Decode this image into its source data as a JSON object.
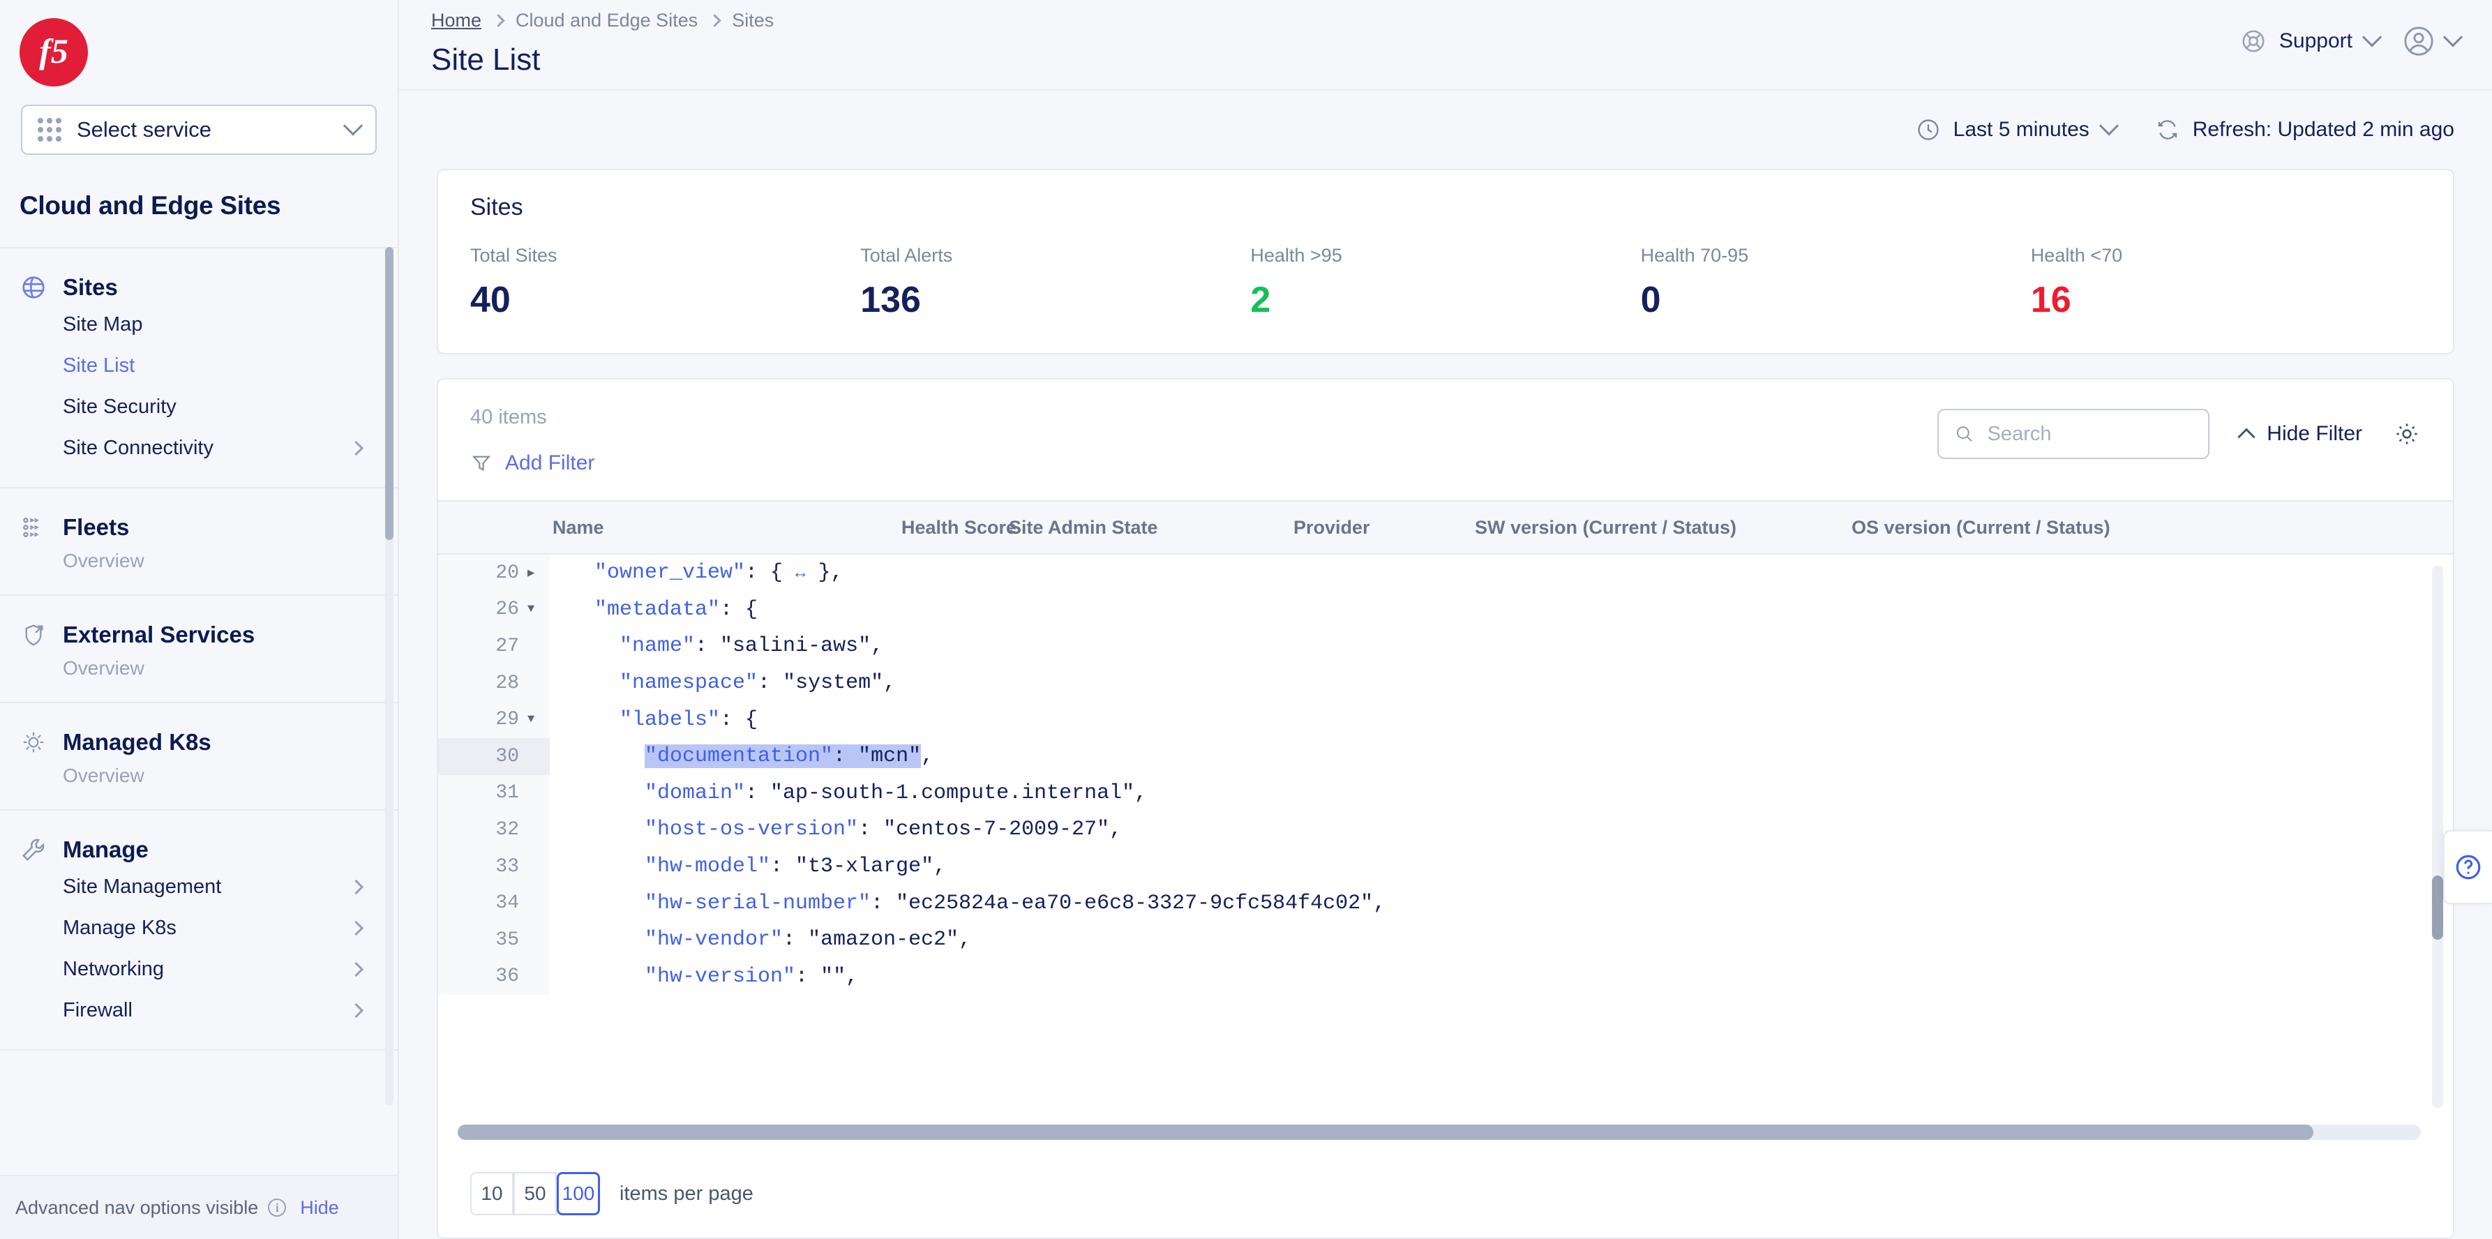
{
  "brand": {
    "logo_text": "f5",
    "accent": "#e21d38"
  },
  "sidebar": {
    "service_selector": {
      "label": "Select service",
      "icon": "grid-dots-icon"
    },
    "heading": "Cloud and Edge Sites",
    "groups": [
      {
        "title": "Sites",
        "icon": "globe-icon",
        "subtitle": null,
        "items": [
          {
            "label": "Site Map",
            "active": false,
            "chevron": false
          },
          {
            "label": "Site List",
            "active": true,
            "chevron": false
          },
          {
            "label": "Site Security",
            "active": false,
            "chevron": false
          },
          {
            "label": "Site Connectivity",
            "active": false,
            "chevron": true
          }
        ]
      },
      {
        "title": "Fleets",
        "icon": "fleets-icon",
        "subtitle": "Overview",
        "items": []
      },
      {
        "title": "External Services",
        "icon": "shield-arrow-icon",
        "subtitle": "Overview",
        "items": []
      },
      {
        "title": "Managed K8s",
        "icon": "helm-wheel-icon",
        "subtitle": "Overview",
        "items": []
      },
      {
        "title": "Manage",
        "icon": "wrench-icon",
        "subtitle": null,
        "items": [
          {
            "label": "Site Management",
            "active": false,
            "chevron": true
          },
          {
            "label": "Manage K8s",
            "active": false,
            "chevron": true
          },
          {
            "label": "Networking",
            "active": false,
            "chevron": true
          },
          {
            "label": "Firewall",
            "active": false,
            "chevron": true
          }
        ]
      }
    ],
    "footer": {
      "text": "Advanced nav options visible",
      "info_icon": "info-icon",
      "hide_label": "Hide"
    }
  },
  "header": {
    "breadcrumbs": [
      "Home",
      "Cloud and Edge Sites",
      "Sites"
    ],
    "title": "Site List",
    "support_label": "Support",
    "support_icon": "lifebuoy-icon",
    "account_icon": "user-circle-icon"
  },
  "toolbar": {
    "time_range": "Last 5 minutes",
    "time_icon": "clock-icon",
    "refresh_label": "Refresh: Updated 2 min ago",
    "refresh_icon": "refresh-icon"
  },
  "stats": {
    "title": "Sites",
    "cards": [
      {
        "label": "Total Sites",
        "value": "40",
        "color": "#16205c"
      },
      {
        "label": "Total Alerts",
        "value": "136",
        "color": "#16205c"
      },
      {
        "label": "Health >95",
        "value": "2",
        "color": "#13c05a"
      },
      {
        "label": "Health 70-95",
        "value": "0",
        "color": "#16205c"
      },
      {
        "label": "Health <70",
        "value": "16",
        "color": "#ee1b2e"
      }
    ]
  },
  "table": {
    "items_count": "40 items",
    "add_filter_label": "Add Filter",
    "add_filter_icon": "funnel-icon",
    "search_placeholder": "Search",
    "search_value": "",
    "search_icon": "search-icon",
    "hide_filter_label": "Hide Filter",
    "settings_icon": "gear-icon",
    "columns": [
      "Name",
      "Health Score",
      "Site Admin State",
      "Provider",
      "SW version (Current / Status)",
      "OS version (Current / Status)"
    ]
  },
  "code_viewer": {
    "lines": [
      {
        "num": "20",
        "fold": "collapsed",
        "highlight": false,
        "indent": 1,
        "parts": [
          {
            "t": "\"owner_view\"",
            "c": "k"
          },
          {
            "t": ": { ",
            "c": "p"
          },
          {
            "t": "↔",
            "c": "e"
          },
          {
            "t": " },",
            "c": "p"
          }
        ]
      },
      {
        "num": "26",
        "fold": "expanded",
        "highlight": false,
        "indent": 1,
        "parts": [
          {
            "t": "\"metadata\"",
            "c": "k"
          },
          {
            "t": ": {",
            "c": "p"
          }
        ]
      },
      {
        "num": "27",
        "fold": "none",
        "highlight": false,
        "indent": 2,
        "parts": [
          {
            "t": "\"name\"",
            "c": "k"
          },
          {
            "t": ": ",
            "c": "p"
          },
          {
            "t": "\"salini-aws\"",
            "c": "v"
          },
          {
            "t": ",",
            "c": "p"
          }
        ]
      },
      {
        "num": "28",
        "fold": "none",
        "highlight": false,
        "indent": 2,
        "parts": [
          {
            "t": "\"namespace\"",
            "c": "k"
          },
          {
            "t": ": ",
            "c": "p"
          },
          {
            "t": "\"system\"",
            "c": "v"
          },
          {
            "t": ",",
            "c": "p"
          }
        ]
      },
      {
        "num": "29",
        "fold": "expanded",
        "highlight": false,
        "indent": 2,
        "parts": [
          {
            "t": "\"labels\"",
            "c": "k"
          },
          {
            "t": ": {",
            "c": "p"
          }
        ]
      },
      {
        "num": "30",
        "fold": "none",
        "highlight": true,
        "indent": 3,
        "selected": true,
        "parts": [
          {
            "t": "\"documentation\"",
            "c": "k sel"
          },
          {
            "t": ": ",
            "c": "p sel"
          },
          {
            "t": "\"mcn\"",
            "c": "v sel"
          },
          {
            "t": ",",
            "c": "p"
          }
        ]
      },
      {
        "num": "31",
        "fold": "none",
        "highlight": false,
        "indent": 3,
        "parts": [
          {
            "t": "\"domain\"",
            "c": "k"
          },
          {
            "t": ": ",
            "c": "p"
          },
          {
            "t": "\"ap-south-1.compute.internal\"",
            "c": "v"
          },
          {
            "t": ",",
            "c": "p"
          }
        ]
      },
      {
        "num": "32",
        "fold": "none",
        "highlight": false,
        "indent": 3,
        "parts": [
          {
            "t": "\"host-os-version\"",
            "c": "k"
          },
          {
            "t": ": ",
            "c": "p"
          },
          {
            "t": "\"centos-7-2009-27\"",
            "c": "v"
          },
          {
            "t": ",",
            "c": "p"
          }
        ]
      },
      {
        "num": "33",
        "fold": "none",
        "highlight": false,
        "indent": 3,
        "parts": [
          {
            "t": "\"hw-model\"",
            "c": "k"
          },
          {
            "t": ": ",
            "c": "p"
          },
          {
            "t": "\"t3-xlarge\"",
            "c": "v"
          },
          {
            "t": ",",
            "c": "p"
          }
        ]
      },
      {
        "num": "34",
        "fold": "none",
        "highlight": false,
        "indent": 3,
        "parts": [
          {
            "t": "\"hw-serial-number\"",
            "c": "k"
          },
          {
            "t": ": ",
            "c": "p"
          },
          {
            "t": "\"ec25824a-ea70-e6c8-3327-9cfc584f4c02\"",
            "c": "v"
          },
          {
            "t": ",",
            "c": "p"
          }
        ]
      },
      {
        "num": "35",
        "fold": "none",
        "highlight": false,
        "indent": 3,
        "parts": [
          {
            "t": "\"hw-vendor\"",
            "c": "k"
          },
          {
            "t": ": ",
            "c": "p"
          },
          {
            "t": "\"amazon-ec2\"",
            "c": "v"
          },
          {
            "t": ",",
            "c": "p"
          }
        ]
      },
      {
        "num": "36",
        "fold": "none",
        "highlight": false,
        "indent": 3,
        "parts": [
          {
            "t": "\"hw-version\"",
            "c": "k"
          },
          {
            "t": ": ",
            "c": "p"
          },
          {
            "t": "\"\"",
            "c": "v"
          },
          {
            "t": ",",
            "c": "p"
          }
        ]
      }
    ]
  },
  "pagination": {
    "options": [
      "10",
      "50",
      "100"
    ],
    "selected": "100",
    "label": "items per page"
  },
  "help": {
    "icon": "question-circle-icon"
  }
}
